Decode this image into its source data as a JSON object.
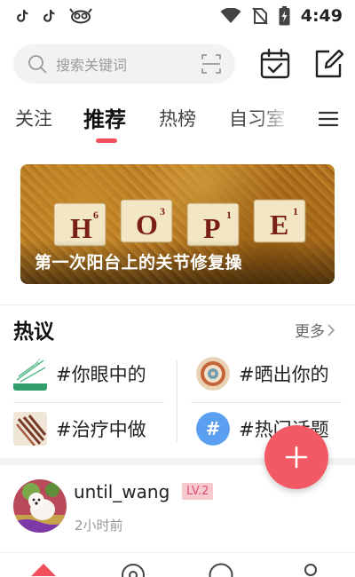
{
  "status_bar": {
    "time": "4:49",
    "icons": [
      "tiktok-icon",
      "tiktok-icon",
      "app-mascot-icon",
      "wifi-icon",
      "no-sim-icon",
      "battery-icon"
    ]
  },
  "search": {
    "placeholder": "搜索关键词"
  },
  "tabs": [
    {
      "label": "关注"
    },
    {
      "label": "推荐"
    },
    {
      "label": "热榜"
    },
    {
      "label": "自习室"
    }
  ],
  "banner": {
    "caption": "第一次阳台上的关节修复操",
    "tiles": [
      {
        "letter": "H",
        "score": "6"
      },
      {
        "letter": "O",
        "score": "3"
      },
      {
        "letter": "P",
        "score": "1"
      },
      {
        "letter": "E",
        "score": "1"
      }
    ]
  },
  "hot": {
    "title": "热议",
    "more": "更多",
    "topics": [
      {
        "text": "#你眼中的"
      },
      {
        "text": "#晒出你的"
      },
      {
        "text": "#治疗中做"
      },
      {
        "text": "#热门话题"
      }
    ]
  },
  "post": {
    "username": "until_wang",
    "level": "LV.2",
    "time": "2小时前"
  },
  "colors": {
    "accent": "#f0505a",
    "badge_bg": "#f6c9d1",
    "badge_text": "#e2506a"
  }
}
